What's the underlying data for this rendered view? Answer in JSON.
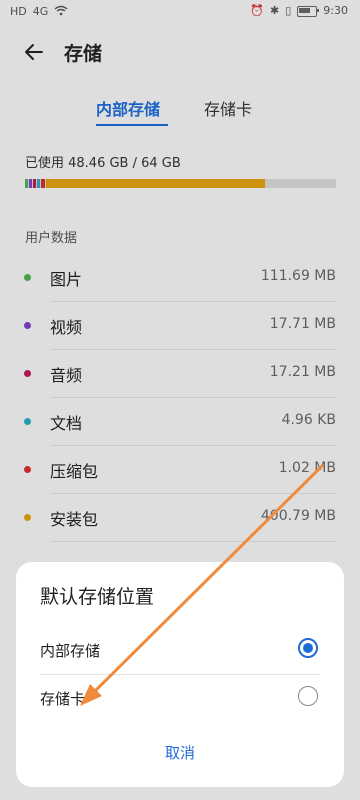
{
  "status_bar": {
    "left_labels": [
      "HD",
      "4G",
      "wifi"
    ],
    "time": "9:30"
  },
  "header": {
    "title": "存储"
  },
  "tabs": [
    {
      "label": "内部存储",
      "active": true
    },
    {
      "label": "存储卡",
      "active": false
    }
  ],
  "usage": {
    "text": "已使用 48.46 GB / 64 GB",
    "used_fraction": 0.757,
    "segment_colors": [
      "#4caf50",
      "#7e3fc8",
      "#c2185b",
      "#2aa7bf",
      "#d32f2f",
      "#e0a010"
    ]
  },
  "section": {
    "label": "用户数据"
  },
  "list": [
    {
      "name": "图片",
      "size": "111.69 MB",
      "color": "#4caf50"
    },
    {
      "name": "视频",
      "size": "17.71 MB",
      "color": "#7e3fc8"
    },
    {
      "name": "音频",
      "size": "17.21 MB",
      "color": "#c2185b"
    },
    {
      "name": "文档",
      "size": "4.96 KB",
      "color": "#2aa7bf"
    },
    {
      "name": "压缩包",
      "size": "1.02 MB",
      "color": "#d32f2f"
    },
    {
      "name": "安装包",
      "size": "400.79 MB",
      "color": "#e0a010"
    }
  ],
  "dialog": {
    "title": "默认存储位置",
    "options": [
      {
        "label": "内部存储",
        "selected": true
      },
      {
        "label": "存储卡",
        "selected": false
      }
    ],
    "cancel_label": "取消"
  },
  "colors": {
    "accent": "#1e6cd6",
    "annotation": "#f08a3c"
  }
}
